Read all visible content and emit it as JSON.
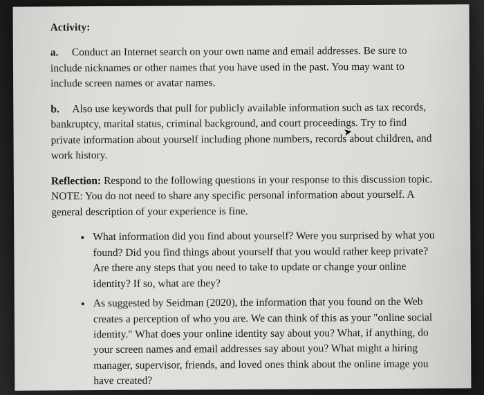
{
  "heading": "Activity:",
  "item_a": {
    "label": "a.",
    "text": "Conduct an Internet search on your own name and email addresses. Be sure to include nicknames or other names that you have used in the past. You may want to include screen names or avatar names."
  },
  "item_b": {
    "label": "b.",
    "text": "Also use keywords that pull for publicly available information such as tax records, bankruptcy, marital status, criminal background, and court proceedings. Try to find private information about yourself including phone numbers, records about children, and work history."
  },
  "reflection": {
    "label": "Reflection:",
    "text": "Respond to the following questions in your response to this discussion topic. NOTE: You do not need to share any specific personal information about yourself. A general description of your experience is fine."
  },
  "bullets": [
    "What information did you find about yourself? Were you surprised by what you found? Did you find things about yourself that you would rather keep private? Are there any steps that you need to take to update or change your online identity? If so, what are they?",
    "As suggested by Seidman (2020), the information that you found on the Web creates a perception of who you are. We can think of this as your \"online social identity.\" What does your online identity say about you? What, if anything, do your screen names and email addresses say about you? What might a hiring manager, supervisor, friends, and loved ones think about the online image you have created?"
  ]
}
